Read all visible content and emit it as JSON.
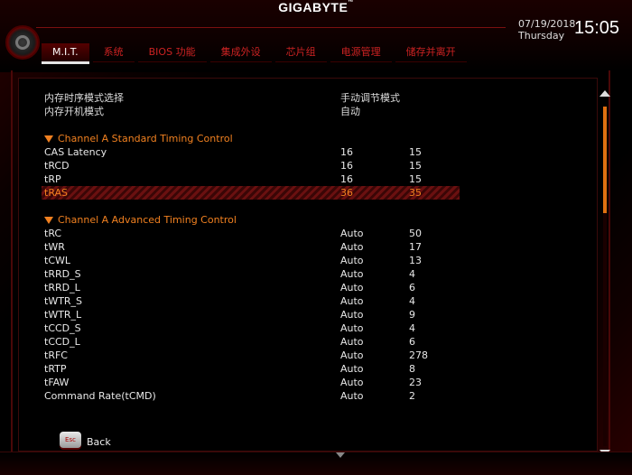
{
  "brand": {
    "logo": "GIGABYTE",
    "tm": "™"
  },
  "clock": {
    "date": "07/19/2018",
    "day": "Thursday",
    "time": "15:05"
  },
  "tabs": [
    {
      "label": "M.I.T.",
      "active": true
    },
    {
      "label": "系统"
    },
    {
      "label": "BIOS 功能"
    },
    {
      "label": "集成外设"
    },
    {
      "label": "芯片组"
    },
    {
      "label": "电源管理"
    },
    {
      "label": "储存并离开"
    }
  ],
  "settings": [
    {
      "label": "内存时序模式选择",
      "value": "手动调节模式"
    },
    {
      "label": "内存开机模式",
      "value": "自动"
    }
  ],
  "standard_section": {
    "title": "Channel A Standard Timing Control",
    "rows": [
      {
        "name": "CAS Latency",
        "setting": "16",
        "current": "15"
      },
      {
        "name": "tRCD",
        "setting": "16",
        "current": "15"
      },
      {
        "name": "tRP",
        "setting": "16",
        "current": "15"
      },
      {
        "name": "tRAS",
        "setting": "36",
        "current": "35"
      }
    ]
  },
  "advanced_section": {
    "title": "Channel A Advanced Timing Control",
    "rows": [
      {
        "name": "tRC",
        "setting": "Auto",
        "current": "50"
      },
      {
        "name": "tWR",
        "setting": "Auto",
        "current": "17"
      },
      {
        "name": "tCWL",
        "setting": "Auto",
        "current": "13"
      },
      {
        "name": "tRRD_S",
        "setting": "Auto",
        "current": "4"
      },
      {
        "name": "tRRD_L",
        "setting": "Auto",
        "current": "6"
      },
      {
        "name": "tWTR_S",
        "setting": "Auto",
        "current": "4"
      },
      {
        "name": "tWTR_L",
        "setting": "Auto",
        "current": "9"
      },
      {
        "name": "tCCD_S",
        "setting": "Auto",
        "current": "4"
      },
      {
        "name": "tCCD_L",
        "setting": "Auto",
        "current": "6"
      },
      {
        "name": "tRFC",
        "setting": "Auto",
        "current": "278"
      },
      {
        "name": "tRTP",
        "setting": "Auto",
        "current": "8"
      },
      {
        "name": "tFAW",
        "setting": "Auto",
        "current": "23"
      },
      {
        "name": "Command Rate(tCMD)",
        "setting": "Auto",
        "current": "2"
      }
    ]
  },
  "footer": {
    "esc_key": "Esc",
    "back_label": "Back"
  },
  "colors": {
    "accent": "#f08020",
    "frame_red": "#7a0f0f",
    "highlight_bg": "#6a1010"
  },
  "icons": {
    "menu": "gear-icon",
    "section": "triangle-down-icon"
  }
}
